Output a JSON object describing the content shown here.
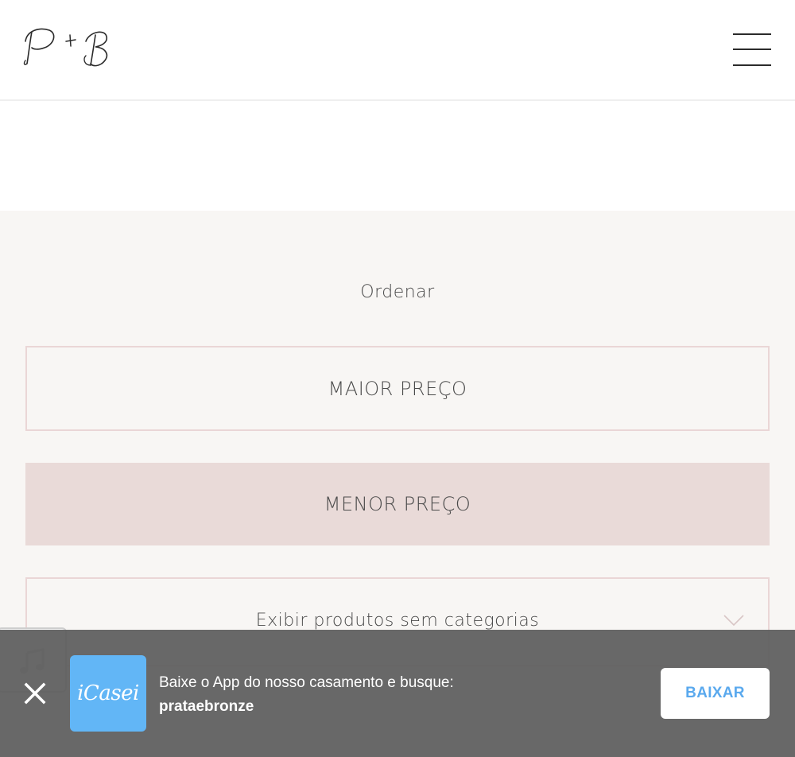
{
  "header": {
    "logo_icon": "p-plus-b-monogram-logo",
    "menu_icon": "hamburger-menu-icon"
  },
  "sort": {
    "title": "Ordenar",
    "options": [
      {
        "label": "MAIOR PREÇO",
        "selected": false
      },
      {
        "label": "MENOR PREÇO",
        "selected": true
      }
    ],
    "category_select": {
      "label": "Exibir produtos sem categorias",
      "icon": "chevron-down-icon"
    }
  },
  "music_widget": {
    "icon": "music-note-icon"
  },
  "app_banner": {
    "close_icon": "close-icon",
    "app_icon_text": "iCasei",
    "line1": "Baixe o App do nosso casamento e busque:",
    "line2": "prataebronze",
    "button_label": "BAIXAR"
  },
  "colors": {
    "section_bg": "#f8f6f4",
    "option_border": "#ead6d6",
    "option_selected_bg": "#e9dad8",
    "banner_bg": "#5f5f5f",
    "app_icon_bg": "#62b6f6",
    "button_text": "#5aa9ee"
  }
}
